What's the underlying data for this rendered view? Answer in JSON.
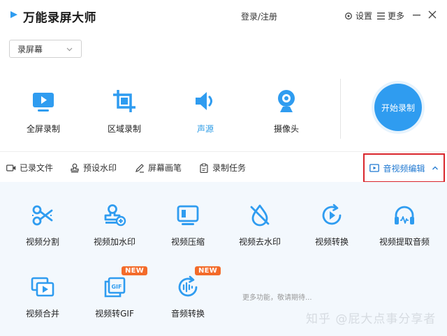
{
  "app": {
    "title": "万能录屏大师",
    "login_label": "登录/注册",
    "settings_label": "设置",
    "more_label": "更多",
    "logo_icon": "play-triangle-icon"
  },
  "mode_select": {
    "selected": "录屏幕"
  },
  "record_modes": [
    {
      "label": "全屏录制",
      "icon": "monitor-play-icon"
    },
    {
      "label": "区域录制",
      "icon": "crop-region-icon"
    },
    {
      "label": "声源",
      "icon": "speaker-icon",
      "active": true
    },
    {
      "label": "摄像头",
      "icon": "webcam-icon"
    }
  ],
  "start_button": {
    "label": "开始录制"
  },
  "toolbar": {
    "recorded_files": "已录文件",
    "preset_watermark": "预设水印",
    "screen_brush": "屏幕画笔",
    "record_tasks": "录制任务",
    "av_edit": "音视频编辑"
  },
  "features": [
    {
      "label": "视频分割",
      "icon": "scissors-icon"
    },
    {
      "label": "视频加水印",
      "icon": "stamp-icon"
    },
    {
      "label": "视频压缩",
      "icon": "compress-icon"
    },
    {
      "label": "视频去水印",
      "icon": "drop-remove-icon"
    },
    {
      "label": "视频转换",
      "icon": "convert-play-icon"
    },
    {
      "label": "视频提取音频",
      "icon": "headphones-icon"
    },
    {
      "label": "视频合并",
      "icon": "merge-video-icon"
    },
    {
      "label": "视频转GIF",
      "icon": "gif-icon",
      "badge": "NEW"
    },
    {
      "label": "音频转换",
      "icon": "audio-convert-icon",
      "badge": "NEW"
    }
  ],
  "gif_icon_text": "GIF",
  "more_coming": "更多功能，敬请期待...",
  "watermark": "知乎 @屁大点事分享者",
  "colors": {
    "accent": "#2f9cf0",
    "highlight_border": "#d9262c",
    "badge": "#f36b2a",
    "panel_bg": "#f3f8fd"
  }
}
